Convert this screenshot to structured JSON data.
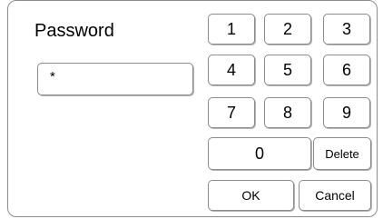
{
  "dialog": {
    "title": "Password",
    "password_value": "*"
  },
  "keypad": {
    "digits": [
      "1",
      "2",
      "3",
      "4",
      "5",
      "6",
      "7",
      "8",
      "9"
    ],
    "zero": "0",
    "delete_label": "Delete",
    "ok_label": "OK",
    "cancel_label": "Cancel"
  },
  "colors": {
    "border": "#8c8c8c",
    "shadow": "#b4b4b4",
    "background": "#ffffff",
    "text": "#000000"
  }
}
